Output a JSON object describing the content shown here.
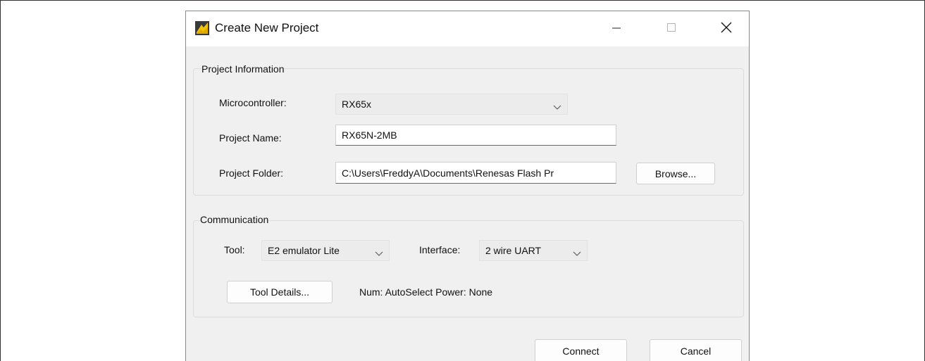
{
  "window": {
    "title": "Create New Project",
    "controls": {
      "minimize": "minimize-icon",
      "maximize": "maximize-icon",
      "close": "close-icon"
    }
  },
  "project_info": {
    "group_label": "Project Information",
    "microcontroller": {
      "label": "Microcontroller:",
      "value": "RX65x"
    },
    "project_name": {
      "label": "Project Name:",
      "value": "RX65N-2MB"
    },
    "project_folder": {
      "label": "Project Folder:",
      "value": "C:\\Users\\FreddyA\\Documents\\Renesas Flash Pr",
      "browse_label": "Browse..."
    }
  },
  "communication": {
    "group_label": "Communication",
    "tool": {
      "label": "Tool:",
      "value": "E2 emulator Lite"
    },
    "interface": {
      "label": "Interface:",
      "value": "2 wire UART"
    },
    "tool_details_label": "Tool Details...",
    "status_text": "Num: AutoSelect  Power: None"
  },
  "footer": {
    "connect_label": "Connect",
    "cancel_label": "Cancel"
  },
  "colors": {
    "dialog_bg": "#f0f0f0",
    "dialog_border": "#6b8fb5",
    "titlebar_bg": "#ffffff",
    "icon_accent": "#f2c300"
  }
}
